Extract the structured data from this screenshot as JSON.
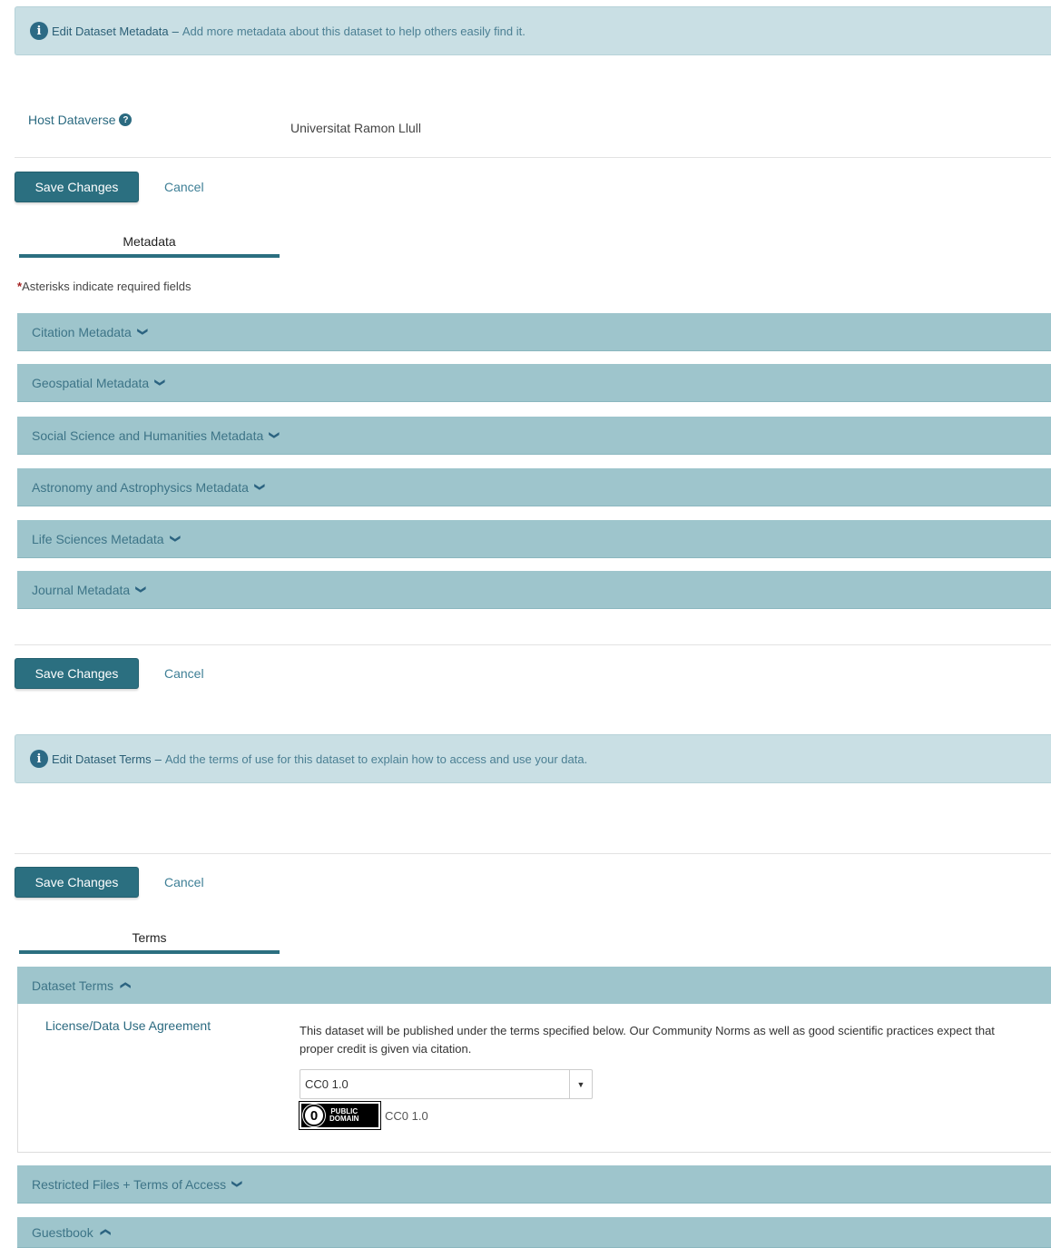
{
  "metadata_banner": {
    "title": "Edit Dataset Metadata",
    "dash": "–",
    "text": "Add more metadata about this dataset to help others easily find it."
  },
  "host": {
    "label": "Host Dataverse",
    "value": "Universitat Ramon Llull"
  },
  "buttons": {
    "save_label": "Save Changes",
    "cancel_label": "Cancel"
  },
  "metadata_tab": {
    "label": "Metadata"
  },
  "required_note": {
    "asterisk": "*",
    "text": "Asterisks indicate required fields"
  },
  "metadata_sections": [
    {
      "label": "Citation Metadata"
    },
    {
      "label": "Geospatial Metadata"
    },
    {
      "label": "Social Science and Humanities Metadata"
    },
    {
      "label": "Astronomy and Astrophysics Metadata"
    },
    {
      "label": "Life Sciences Metadata"
    },
    {
      "label": "Journal Metadata"
    }
  ],
  "terms_banner": {
    "title": "Edit Dataset Terms",
    "dash": "–",
    "text": "Add the terms of use for this dataset to explain how to access and use your data."
  },
  "terms_tab": {
    "label": "Terms"
  },
  "terms_sections": {
    "dataset_terms": {
      "label": "Dataset Terms",
      "expanded": true
    },
    "restricted": {
      "label": "Restricted Files + Terms of Access",
      "expanded": false
    },
    "guestbook": {
      "label": "Guestbook",
      "expanded": true
    }
  },
  "license": {
    "label": "License/Data Use Agreement",
    "description": "This dataset will be published under the terms specified below. Our Community Norms as well as good scientific practices expect that proper credit is given via citation.",
    "selected": "CC0 1.0",
    "badge_zero": "0",
    "badge_line1": "PUBLIC",
    "badge_line2": "DOMAIN",
    "name": "CC0 1.0"
  },
  "icons": {
    "info": "info-icon",
    "help": "question-circle-icon",
    "chevron_down": "chevron-down-icon",
    "chevron_up": "chevron-up-icon",
    "caret": "caret-down-icon"
  },
  "colors": {
    "primary": "#2b6f80",
    "accordion": "#9ec5cc",
    "banner": "#c9dfe4",
    "required": "#a32020"
  }
}
